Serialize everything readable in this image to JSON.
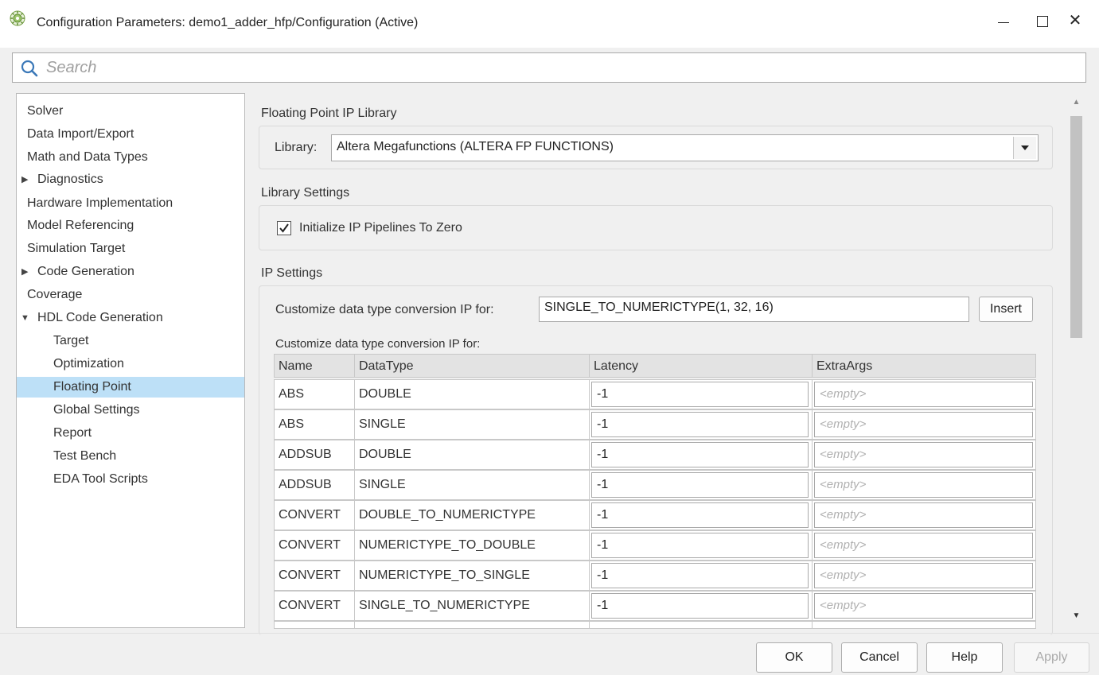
{
  "window": {
    "title": "Configuration Parameters: demo1_adder_hfp/Configuration (Active)",
    "minimize_label": "—",
    "close_label": "✕"
  },
  "search": {
    "placeholder": "Search"
  },
  "nav": {
    "items": [
      {
        "label": "Solver"
      },
      {
        "label": "Data Import/Export"
      },
      {
        "label": "Math and Data Types"
      },
      {
        "label": "Diagnostics"
      },
      {
        "label": "Hardware Implementation"
      },
      {
        "label": "Model Referencing"
      },
      {
        "label": "Simulation Target"
      },
      {
        "label": "Code Generation"
      },
      {
        "label": "Coverage"
      },
      {
        "label": "HDL Code Generation"
      },
      {
        "label": "Target"
      },
      {
        "label": "Optimization"
      },
      {
        "label": "Floating Point"
      },
      {
        "label": "Global Settings"
      },
      {
        "label": "Report"
      },
      {
        "label": "Test Bench"
      },
      {
        "label": "EDA Tool Scripts"
      }
    ],
    "selected": "Floating Point"
  },
  "main": {
    "fp_library": {
      "section_title": "Floating Point IP Library",
      "library_label": "Library:",
      "library_value": "Altera Megafunctions (ALTERA FP FUNCTIONS)"
    },
    "library_settings": {
      "section_title": "Library Settings",
      "init_pipelines_label": "Initialize IP Pipelines To Zero",
      "init_pipelines_checked": true
    },
    "ip_settings": {
      "section_title": "IP Settings",
      "customize_label": "Customize data type conversion IP for:",
      "customize_value": "SINGLE_TO_NUMERICTYPE(1, 32, 16)",
      "insert_label": "Insert",
      "table_caption": "Customize data type conversion IP for:",
      "columns": [
        "Name",
        "DataType",
        "Latency",
        "ExtraArgs"
      ],
      "rows": [
        {
          "name": "ABS",
          "datatype": "DOUBLE",
          "latency": "-1",
          "extra": "<empty>"
        },
        {
          "name": "ABS",
          "datatype": "SINGLE",
          "latency": "-1",
          "extra": "<empty>"
        },
        {
          "name": "ADDSUB",
          "datatype": "DOUBLE",
          "latency": "-1",
          "extra": "<empty>"
        },
        {
          "name": "ADDSUB",
          "datatype": "SINGLE",
          "latency": "-1",
          "extra": "<empty>"
        },
        {
          "name": "CONVERT",
          "datatype": "DOUBLE_TO_NUMERICTYPE",
          "latency": "-1",
          "extra": "<empty>"
        },
        {
          "name": "CONVERT",
          "datatype": "NUMERICTYPE_TO_DOUBLE",
          "latency": "-1",
          "extra": "<empty>"
        },
        {
          "name": "CONVERT",
          "datatype": "NUMERICTYPE_TO_SINGLE",
          "latency": "-1",
          "extra": "<empty>"
        },
        {
          "name": "CONVERT",
          "datatype": "SINGLE_TO_NUMERICTYPE",
          "latency": "-1",
          "extra": "<empty>"
        }
      ]
    }
  },
  "buttons": {
    "ok": "OK",
    "cancel": "Cancel",
    "help": "Help",
    "apply": "Apply"
  },
  "colors": {
    "selection": "#bde0f7",
    "background": "#f0f0f0"
  }
}
